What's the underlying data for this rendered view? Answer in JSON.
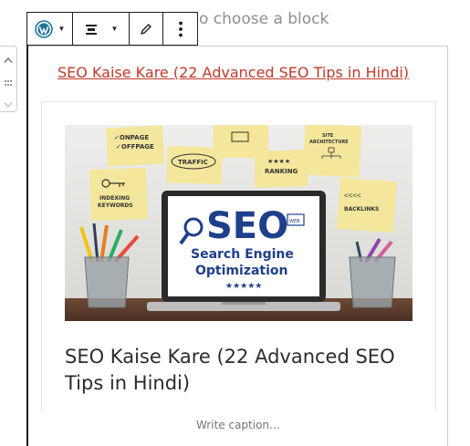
{
  "editor": {
    "placeholder": "o choose a block"
  },
  "toolbar": {
    "block_icon": "wordpress-icon",
    "align_icon": "align-center-icon",
    "edit_icon": "pencil-icon",
    "more_icon": "more-vertical-icon"
  },
  "movers": {
    "up_icon": "chevron-up-icon",
    "drag_icon": "drag-handle-icon",
    "down_icon": "chevron-down-icon"
  },
  "embed": {
    "link_text": "SEO Kaise Kare (22 Advanced SEO Tips in Hindi)",
    "card_title": "SEO Kaise Kare (22 Advanced SEO Tips in Hindi)",
    "image": {
      "notes": [
        "ONPAGE\nOFFPAGE",
        "TRAFFIC",
        "SITE\nARCHITECTURE",
        "RANKING",
        "INDEXING\nKEYWORDS",
        "BACKLINKS"
      ],
      "screen_big": "SEO",
      "screen_line1": "Search Engine",
      "screen_line2": "Optimization",
      "screen_stars": "★★★★★"
    }
  },
  "caption": {
    "placeholder": "Write caption…"
  },
  "colors": {
    "link": "#c0392b",
    "wp_blue": "#21759b",
    "seo_blue": "#1e3f8a"
  }
}
